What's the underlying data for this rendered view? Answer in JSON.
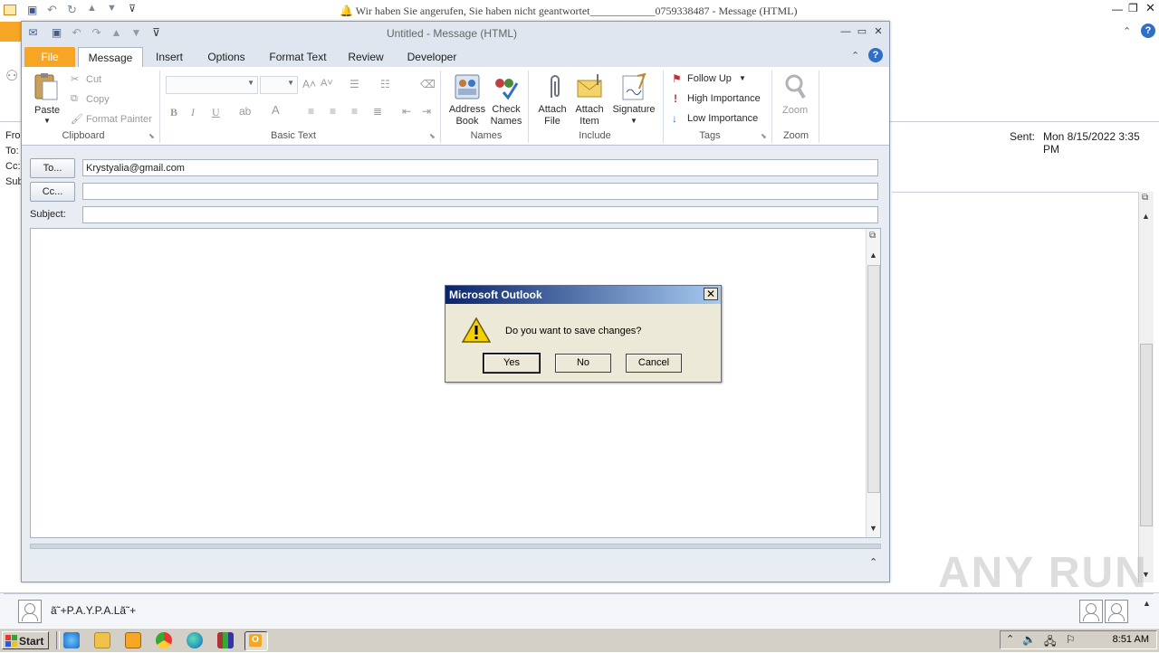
{
  "background_window": {
    "title": "🔔 Wir haben Sie angerufen, Sie haben nicht geantwortet____________0759338487  -  Message (HTML)",
    "header_labels": {
      "from": "Fro",
      "to": "To:",
      "cc": "Cc:",
      "subject": "Subj"
    },
    "sent_label": "Sent:",
    "sent_value": "Mon 8/15/2022 3:35 PM",
    "sender_name": "ã˜+P.A.Y.P.A.Lã˜+"
  },
  "compose": {
    "title": "Untitled  -  Message (HTML)",
    "tabs": [
      {
        "label": "File"
      },
      {
        "label": "Message"
      },
      {
        "label": "Insert"
      },
      {
        "label": "Options"
      },
      {
        "label": "Format Text"
      },
      {
        "label": "Review"
      },
      {
        "label": "Developer"
      }
    ],
    "ribbon": {
      "clipboard": {
        "paste": "Paste",
        "cut": "Cut",
        "copy": "Copy",
        "format_painter": "Format Painter",
        "group": "Clipboard"
      },
      "basic_text": {
        "group": "Basic Text",
        "bold": "B",
        "italic": "I",
        "underline": "U"
      },
      "names": {
        "address_book": "Address Book",
        "check_names": "Check Names",
        "group": "Names"
      },
      "include": {
        "attach_file": "Attach File",
        "attach_item": "Attach Item",
        "signature": "Signature",
        "group": "Include"
      },
      "tags": {
        "follow_up": "Follow Up",
        "high_importance": "High Importance",
        "low_importance": "Low Importance",
        "group": "Tags"
      },
      "zoom": {
        "zoom": "Zoom",
        "group": "Zoom"
      }
    },
    "fields": {
      "to_button": "To...",
      "to_value": "Krystyalia@gmail.com",
      "cc_button": "Cc...",
      "cc_value": "",
      "subject_label": "Subject:",
      "subject_value": ""
    }
  },
  "dialog": {
    "title": "Microsoft Outlook",
    "message": "Do you want to save changes?",
    "buttons": {
      "yes": "Yes",
      "no": "No",
      "cancel": "Cancel"
    }
  },
  "taskbar": {
    "start": "Start",
    "clock": "8:51 AM"
  },
  "watermark": "ANY RUN",
  "colors": {
    "file_tab": "#f6a624",
    "dialog_title_start": "#0a246a",
    "dialog_title_end": "#a6caf0",
    "help_blue": "#2f6fc6"
  }
}
